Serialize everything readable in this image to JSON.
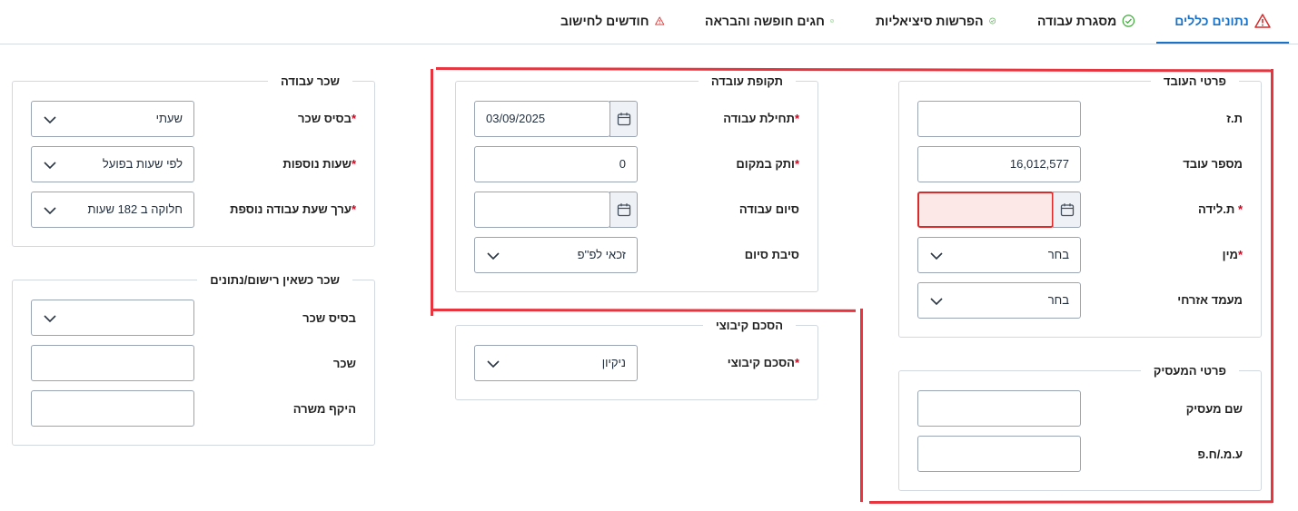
{
  "tabs": [
    {
      "label": "נתונים כללים",
      "status": "warning-icon",
      "active": true
    },
    {
      "label": "מסגרת עבודה",
      "status": "check-circle-icon",
      "active": false
    },
    {
      "label": "הפרשות סיציאליות",
      "status": "check-circle-icon",
      "active": false
    },
    {
      "label": "חגים חופשה והבראה",
      "status": "check-circle-icon",
      "active": false
    },
    {
      "label": "חודשים לחישוב",
      "status": "warning-icon",
      "active": false
    }
  ],
  "employee_details": {
    "title": "פרטי העובד",
    "id_label": "ת.ז",
    "id_value": "",
    "employee_number_label": "מספר עובד",
    "employee_number_value": "16,012,577",
    "birth_date_label": "ת.לידה",
    "birth_date_value": "",
    "gender_label": "מין",
    "gender_value": "בחר",
    "marital_status_label": "מעמד אזרחי",
    "marital_status_value": "בחר"
  },
  "employer_details": {
    "title": "פרטי המעסיק",
    "employer_name_label": "שם מעסיק",
    "employer_name_value": "",
    "company_id_label": "ע.מ./ח.פ",
    "company_id_value": ""
  },
  "work_period": {
    "title": "תקופת עובדה",
    "start_label": "תחילת עבודה",
    "start_value": "03/09/2025",
    "seniority_label": "ותק במקום",
    "seniority_value": "0",
    "end_label": "סיום עבודה",
    "end_value": "",
    "termination_reason_label": "סיבת סיום",
    "termination_reason_value": "זכאי לפ''פ"
  },
  "collective_agreement": {
    "title": "הסכם קיבוצי",
    "agreement_label": "הסכם קיבוצי",
    "agreement_value": "ניקיון"
  },
  "wage": {
    "title": "שכר עבודה",
    "basis_label": "בסיס שכר",
    "basis_value": "שעתי",
    "overtime_label": "שעות נוספות",
    "overtime_value": "לפי שעות בפועל",
    "overtime_rate_label": "ערך שעת עבודה נוספת",
    "overtime_rate_value": "חלוקה ב 182 שעות"
  },
  "unregistered_wage": {
    "title": "שכר כשאין רישום/נתונים",
    "basis_label": "בסיס שכר",
    "basis_value": "",
    "wage_label": "שכר",
    "wage_value": "",
    "position_scope_label": "היקף משרה",
    "position_scope_value": ""
  },
  "colors": {
    "accent": "#1b73c7",
    "warning": "#d92b2b",
    "success": "#3aa935",
    "annotation": "#e8343f"
  }
}
